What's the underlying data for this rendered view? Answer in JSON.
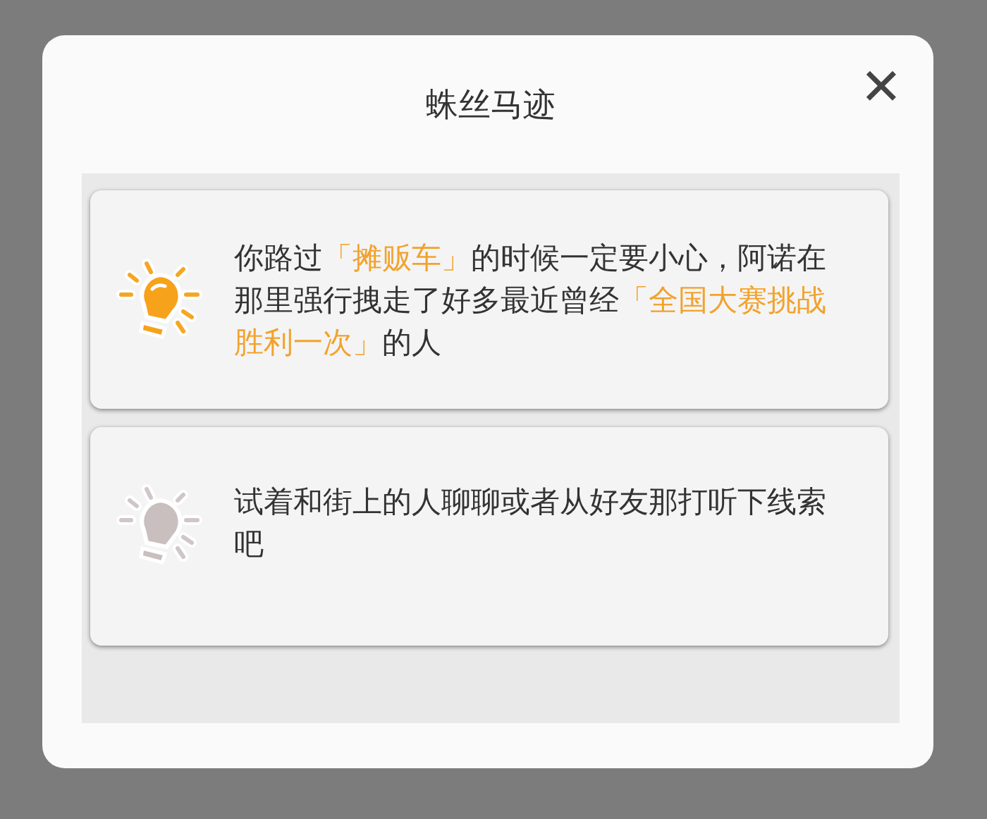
{
  "dialog": {
    "title": "蛛丝马迹",
    "close": "✕"
  },
  "clues": [
    {
      "unlocked": true,
      "segments": [
        {
          "text": "你路过",
          "highlight": false
        },
        {
          "text": "「摊贩车」",
          "highlight": true
        },
        {
          "text": "的时候一定要小心，阿诺在那里强行拽走了好多最近曾经",
          "highlight": false
        },
        {
          "text": "「全国大赛挑战胜利一次」",
          "highlight": true
        },
        {
          "text": "的人",
          "highlight": false
        }
      ]
    },
    {
      "unlocked": false,
      "segments": [
        {
          "text": "试着和街上的人聊聊或者从好友那打听下线索吧",
          "highlight": false
        }
      ]
    }
  ]
}
